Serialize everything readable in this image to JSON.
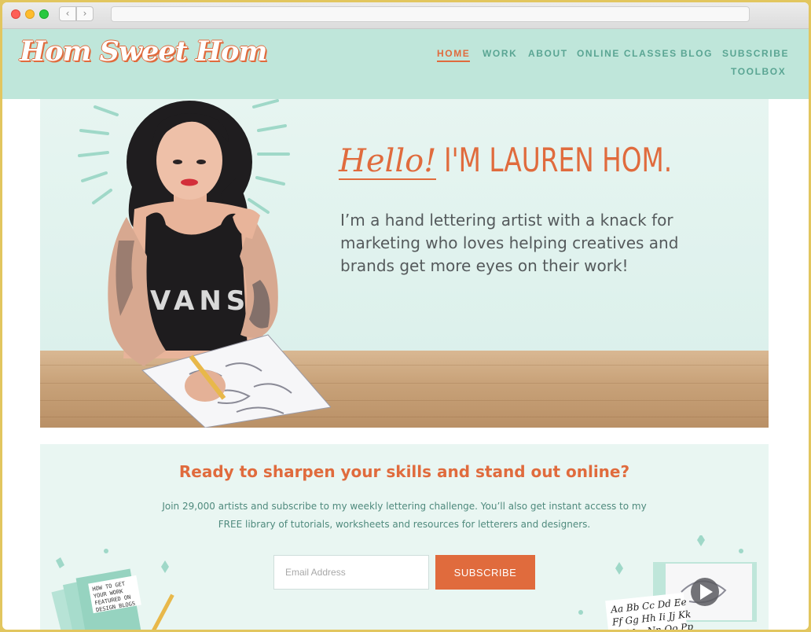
{
  "site": {
    "logo_text": "Hom Sweet Hom"
  },
  "nav": {
    "items": [
      {
        "label": "HOME",
        "active": true
      },
      {
        "label": "WORK"
      },
      {
        "label": "ABOUT"
      },
      {
        "label": "ONLINE CLASSES"
      },
      {
        "label": "BLOG"
      },
      {
        "label": "SUBSCRIBE"
      },
      {
        "label": "TOOLBOX"
      }
    ]
  },
  "hero": {
    "hello": "Hello!",
    "name": "I'M LAUREN HOM.",
    "intro": "I’m a hand lettering artist with a knack for marketing who loves helping creatives and brands get more eyes on their work!",
    "shirt_text": "VANS"
  },
  "signup": {
    "heading": "Ready to sharpen your skills and stand out online?",
    "body": "Join 29,000 artists and subscribe to my weekly lettering challenge. You’ll also get instant access to my FREE library of tutorials, worksheets and resources for letterers and designers.",
    "email_placeholder": "Email Address",
    "button_label": "SUBSCRIBE",
    "book_title": "HOW TO GET YOUR WORK FEATURED ON DESIGN BLOGS",
    "alphabet_lines": [
      "Aa Bb Cc Dd Ee",
      "Ff Gg Hh Ii Jj Kk",
      "Ll Mm Nn Oo Pp"
    ]
  },
  "colors": {
    "header_bg": "#bfe6da",
    "accent": "#e06b3d",
    "nav_text": "#5aa593",
    "hero_bg": "#e7f5f1",
    "signup_bg": "#e9f6f2",
    "frame": "#e2c65f"
  },
  "chrome_icons": [
    "close-dot",
    "minimize-dot",
    "zoom-dot",
    "back-chevron-icon",
    "forward-chevron-icon"
  ]
}
